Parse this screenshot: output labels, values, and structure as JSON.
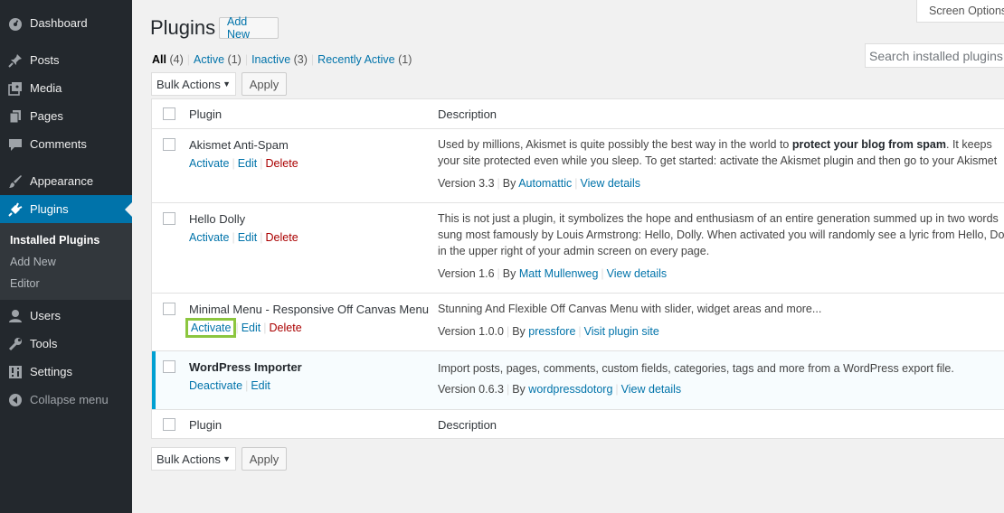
{
  "sidebar": {
    "items": [
      {
        "label": "Dashboard",
        "icon": "dashboard-icon"
      },
      {
        "label": "Posts",
        "icon": "pin-icon"
      },
      {
        "label": "Media",
        "icon": "media-icon"
      },
      {
        "label": "Pages",
        "icon": "pages-icon"
      },
      {
        "label": "Comments",
        "icon": "comment-icon"
      },
      {
        "label": "Appearance",
        "icon": "paintbrush-icon"
      },
      {
        "label": "Plugins",
        "icon": "plugin-icon"
      },
      {
        "label": "Users",
        "icon": "user-icon"
      },
      {
        "label": "Tools",
        "icon": "wrench-icon"
      },
      {
        "label": "Settings",
        "icon": "settings-icon"
      }
    ],
    "submenu": [
      "Installed Plugins",
      "Add New",
      "Editor"
    ],
    "collapse": "Collapse menu"
  },
  "screen_options": "Screen Options",
  "page": {
    "title": "Plugins",
    "add_new": "Add New"
  },
  "filters": {
    "all": "All",
    "all_count": "(4)",
    "active": "Active",
    "active_count": "(1)",
    "inactive": "Inactive",
    "inactive_count": "(3)",
    "recent": "Recently Active",
    "recent_count": "(1)"
  },
  "search": {
    "placeholder": "Search installed plugins..."
  },
  "bulk": {
    "label": "Bulk Actions",
    "apply": "Apply"
  },
  "table": {
    "col_plugin": "Plugin",
    "col_description": "Description"
  },
  "plugins": [
    {
      "name": "Akismet Anti-Spam",
      "actions": [
        "Activate",
        "Edit",
        "Delete"
      ],
      "desc_pre": "Used by millions, Akismet is quite possibly the best way in the world to ",
      "desc_bold": "protect your blog from spam",
      "desc_post": ". It keeps your site protected even while you sleep. To get started: activate the Akismet plugin and then go to your Akismet Settings page to set up your API key.",
      "version": "Version 3.3",
      "by": "By",
      "author": "Automattic",
      "link": "View details"
    },
    {
      "name": "Hello Dolly",
      "actions": [
        "Activate",
        "Edit",
        "Delete"
      ],
      "desc": "This is not just a plugin, it symbolizes the hope and enthusiasm of an entire generation summed up in two words sung most famously by Louis Armstrong: Hello, Dolly. When activated you will randomly see a lyric from Hello, Dolly in the upper right of your admin screen on every page.",
      "version": "Version 1.6",
      "by": "By",
      "author": "Matt Mullenweg",
      "link": "View details"
    },
    {
      "name": "Minimal Menu - Responsive Off Canvas Menu",
      "actions": [
        "Activate",
        "Edit",
        "Delete"
      ],
      "desc": "Stunning And Flexible Off Canvas Menu with slider, widget areas and more...",
      "version": "Version 1.0.0",
      "by": "By",
      "author": "pressfore",
      "link": "Visit plugin site"
    },
    {
      "name": "WordPress Importer",
      "actions": [
        "Deactivate",
        "Edit"
      ],
      "desc": "Import posts, pages, comments, custom fields, categories, tags and more from a WordPress export file.",
      "version": "Version 0.6.3",
      "by": "By",
      "author": "wordpressdotorg",
      "link": "View details"
    }
  ],
  "colors": {
    "sidebar_bg": "#23282d",
    "accent": "#0073aa",
    "active_border": "#00a0d2",
    "highlight": "#8cc63f"
  }
}
